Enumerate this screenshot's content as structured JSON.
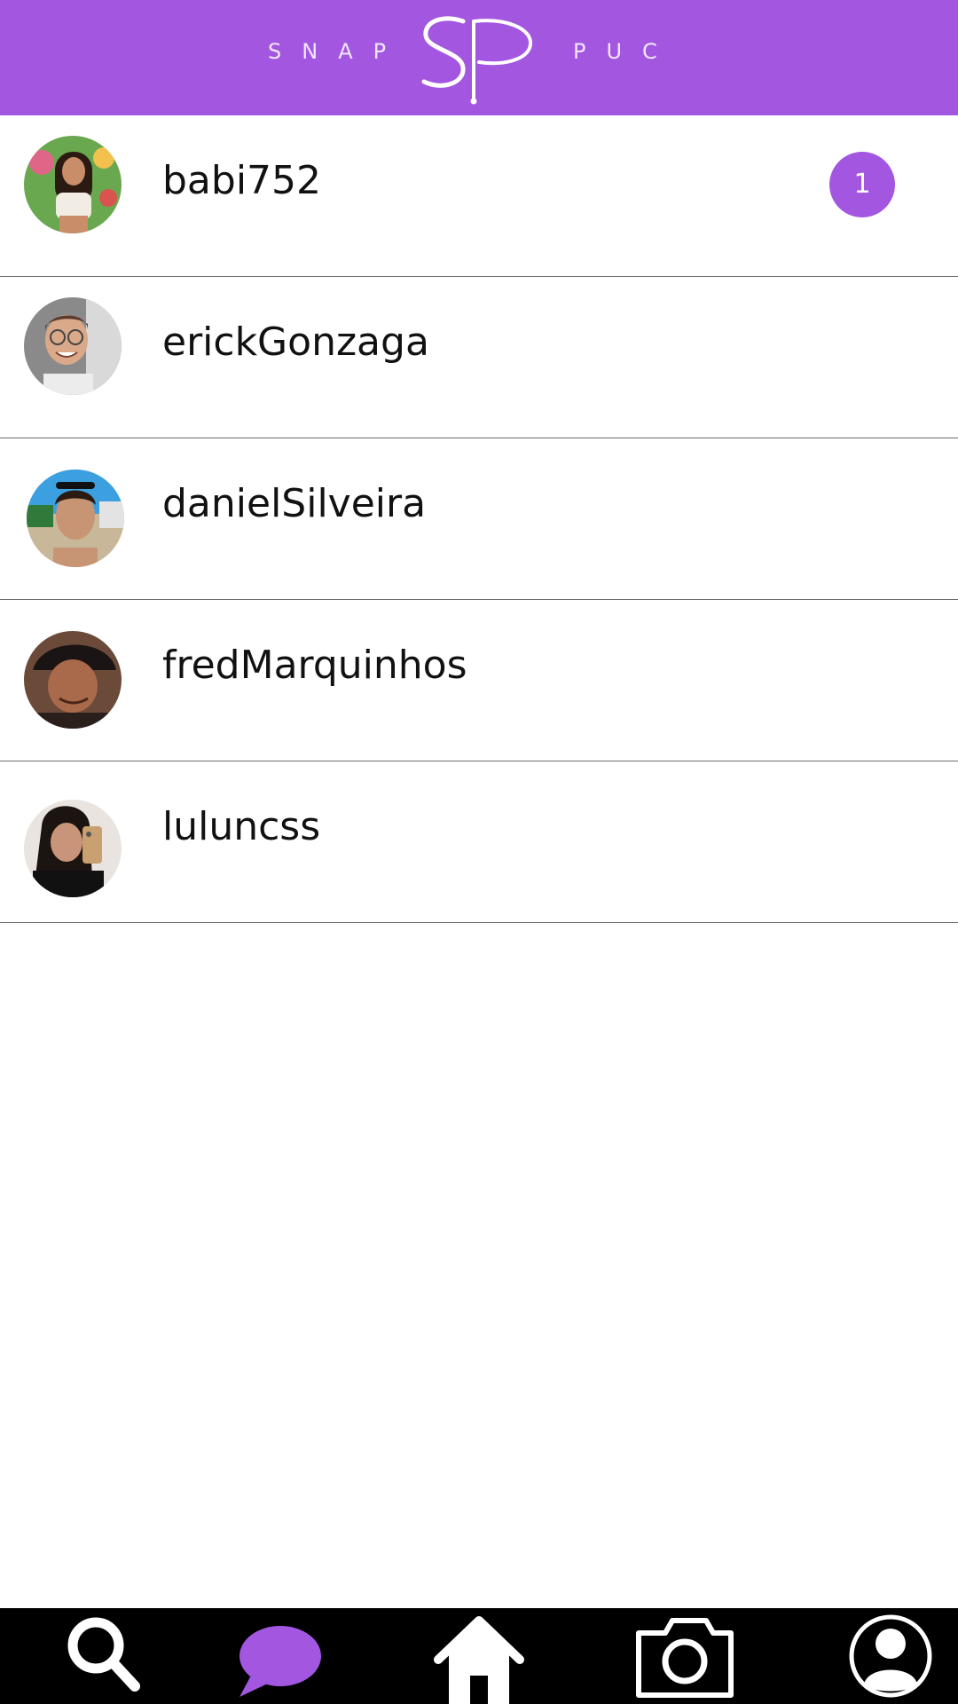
{
  "app": {
    "brand_left": "SNAP",
    "brand_right": "PUC",
    "logo_letters": "SP"
  },
  "colors": {
    "accent": "#a356e0",
    "header_text": "#f2e6ff",
    "nav_background": "#000000",
    "nav_icon": "#ffffff"
  },
  "chats": [
    {
      "username": "babi752",
      "unread": "1",
      "avatar": "avatar-babi752"
    },
    {
      "username": "erickGonzaga",
      "unread": null,
      "avatar": "avatar-erickGonzaga"
    },
    {
      "username": "danielSilveira",
      "unread": null,
      "avatar": "avatar-danielSilveira"
    },
    {
      "username": "fredMarquinhos",
      "unread": null,
      "avatar": "avatar-fredMarquinhos"
    },
    {
      "username": "luluncss",
      "unread": null,
      "avatar": "avatar-luluncss"
    }
  ],
  "nav": {
    "items": [
      {
        "icon": "search-icon",
        "active": false
      },
      {
        "icon": "chat-bubble-icon",
        "active": true
      },
      {
        "icon": "home-icon",
        "active": false
      },
      {
        "icon": "camera-icon",
        "active": false
      },
      {
        "icon": "profile-icon",
        "active": false
      }
    ]
  }
}
